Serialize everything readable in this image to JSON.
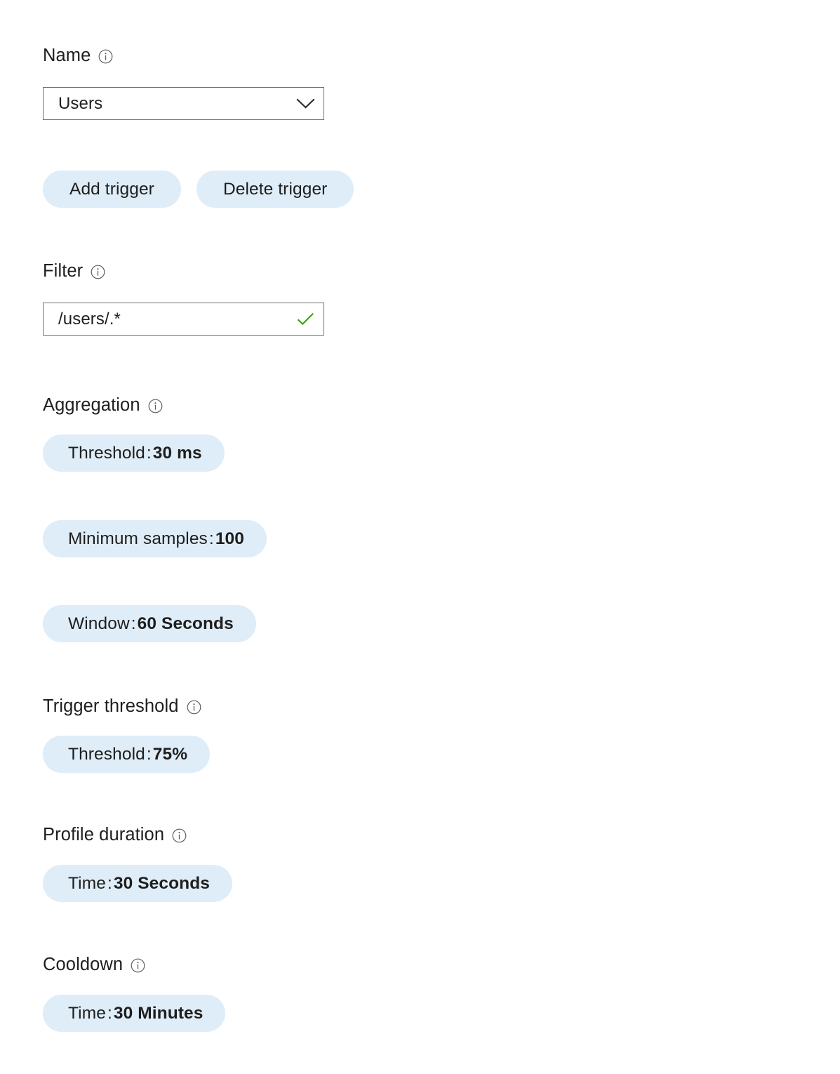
{
  "form": {
    "name_field": {
      "label": "Name",
      "info_icon": "info-icon",
      "value": "Users",
      "dropdown_icon": "chevron-down-icon"
    },
    "trigger_actions": {
      "add_label": "Add trigger",
      "delete_label": "Delete trigger"
    },
    "filter_field": {
      "label": "Filter",
      "info_icon": "info-icon",
      "value": "/users/.*",
      "validation_icon": "checkmark-icon",
      "validation_color": "#3fa218"
    },
    "aggregation": {
      "label": "Aggregation",
      "info_icon": "info-icon",
      "pills": [
        {
          "key": "Threshold",
          "separator": ":",
          "value": "30 ms"
        },
        {
          "key": "Minimum samples",
          "separator": ":",
          "value": "100"
        },
        {
          "key": "Window",
          "separator": ":",
          "value": "60 Seconds"
        }
      ]
    },
    "trigger_threshold": {
      "label": "Trigger threshold",
      "info_icon": "info-icon",
      "pills": [
        {
          "key": "Threshold",
          "separator": ":",
          "value": "75%"
        }
      ]
    },
    "profile_duration": {
      "label": "Profile duration",
      "info_icon": "info-icon",
      "pills": [
        {
          "key": "Time",
          "separator": ":",
          "value": "30 Seconds"
        }
      ]
    },
    "cooldown": {
      "label": "Cooldown",
      "info_icon": "info-icon",
      "pills": [
        {
          "key": "Time",
          "separator": ":",
          "value": "30 Minutes"
        }
      ]
    }
  },
  "colors": {
    "pill_background": "#dfedf8",
    "text": "#201f1e",
    "input_border": "#6f6e6d",
    "success": "#3fa218"
  }
}
